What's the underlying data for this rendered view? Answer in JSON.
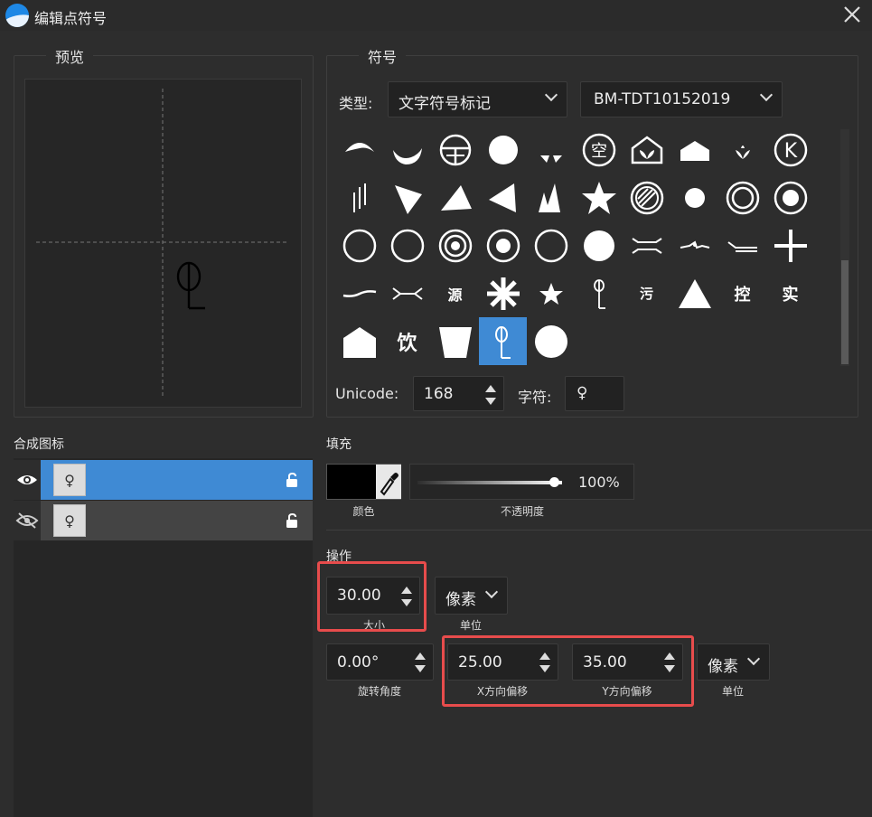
{
  "window": {
    "title": "编辑点符号",
    "close_symbol": "✕"
  },
  "preview": {
    "title": "预览",
    "glyph": "♀"
  },
  "symbols": {
    "title": "符号",
    "type_label": "类型:",
    "type_value": "文字符号标记",
    "font_value": "BM-TDT10152019",
    "grid_text": {
      "yuan": "源",
      "wu": "污",
      "kong": "控",
      "shi": "实",
      "yin": "饮"
    },
    "unicode_label": "Unicode:",
    "unicode_value": "168",
    "char_label": "字符:",
    "char_value": "♀"
  },
  "layers": {
    "title": "合成图标",
    "items": [
      {
        "glyph": "♀",
        "visible": true,
        "selected": true
      },
      {
        "glyph": "♀",
        "visible": false,
        "selected": false
      }
    ]
  },
  "fill": {
    "title": "填充",
    "color_label": "颜色",
    "color": "#000000",
    "opacity_label": "不透明度",
    "opacity_value": "100%",
    "opacity_fraction": 1.0
  },
  "operation": {
    "title": "操作",
    "size_value": "30.00",
    "size_label": "大小",
    "size_unit": "像素",
    "size_unit_label": "单位",
    "rotation_value": "0.00°",
    "rotation_label": "旋转角度",
    "x_offset_value": "25.00",
    "x_offset_label": "X方向偏移",
    "y_offset_value": "35.00",
    "y_offset_label": "Y方向偏移",
    "offset_unit": "像素",
    "offset_unit_label": "单位"
  },
  "colors": {
    "accent": "#3f8ad4",
    "highlight": "#e74c4c",
    "background": "#2d2d2d"
  }
}
